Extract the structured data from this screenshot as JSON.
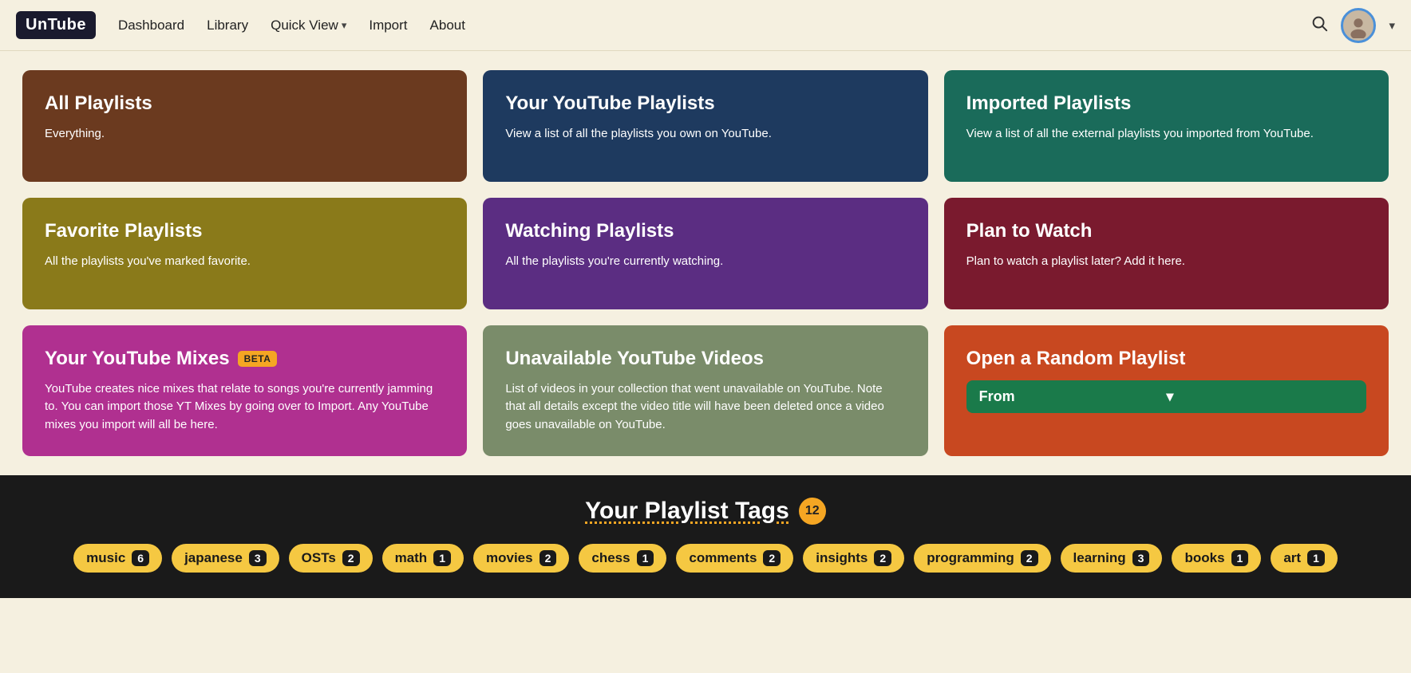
{
  "navbar": {
    "logo": "UnTube",
    "links": [
      {
        "id": "dashboard",
        "label": "Dashboard",
        "dropdown": false
      },
      {
        "id": "library",
        "label": "Library",
        "dropdown": false
      },
      {
        "id": "quickview",
        "label": "Quick View",
        "dropdown": true
      },
      {
        "id": "import",
        "label": "Import",
        "dropdown": false
      },
      {
        "id": "about",
        "label": "About",
        "dropdown": false
      }
    ]
  },
  "cards": [
    {
      "id": "all-playlists",
      "title": "All Playlists",
      "description": "Everything.",
      "color": "card-brown",
      "badge": null
    },
    {
      "id": "youtube-playlists",
      "title": "Your YouTube Playlists",
      "description": "View a list of all the playlists you own on YouTube.",
      "color": "card-navy",
      "badge": null
    },
    {
      "id": "imported-playlists",
      "title": "Imported Playlists",
      "description": "View a list of all the external playlists you imported from YouTube.",
      "color": "card-teal",
      "badge": null
    },
    {
      "id": "favorite-playlists",
      "title": "Favorite Playlists",
      "description": "All the playlists you've marked favorite.",
      "color": "card-olive",
      "badge": null
    },
    {
      "id": "watching-playlists",
      "title": "Watching Playlists",
      "description": "All the playlists you're currently watching.",
      "color": "card-purple",
      "badge": null
    },
    {
      "id": "plan-to-watch",
      "title": "Plan to Watch",
      "description": "Plan to watch a playlist later? Add it here.",
      "color": "card-maroon",
      "badge": null
    },
    {
      "id": "yt-mixes",
      "title": "Your YouTube Mixes",
      "description": "YouTube creates nice mixes that relate to songs you're currently jamming to. You can import those YT Mixes by going over to Import. Any YouTube mixes you import will all be here.",
      "color": "card-magenta",
      "badge": "BETA"
    },
    {
      "id": "unavailable-videos",
      "title": "Unavailable YouTube Videos",
      "description": "List of videos in your collection that went unavailable on YouTube. Note that all details except the video title will have been deleted once a video goes unavailable on YouTube.",
      "color": "card-sage",
      "badge": null
    },
    {
      "id": "random-playlist",
      "title": "Open a Random Playlist",
      "description": null,
      "color": "card-orange",
      "badge": null,
      "dropdown_label": "From"
    }
  ],
  "tags_section": {
    "title": "Your Playlist Tags",
    "count": 12,
    "tags": [
      {
        "label": "music",
        "count": 6
      },
      {
        "label": "japanese",
        "count": 3
      },
      {
        "label": "OSTs",
        "count": 2
      },
      {
        "label": "math",
        "count": 1
      },
      {
        "label": "movies",
        "count": 2
      },
      {
        "label": "chess",
        "count": 1
      },
      {
        "label": "comments",
        "count": 2
      },
      {
        "label": "insights",
        "count": 2
      },
      {
        "label": "programming",
        "count": 2
      },
      {
        "label": "learning",
        "count": 3
      },
      {
        "label": "books",
        "count": 1
      },
      {
        "label": "art",
        "count": 1
      }
    ]
  }
}
